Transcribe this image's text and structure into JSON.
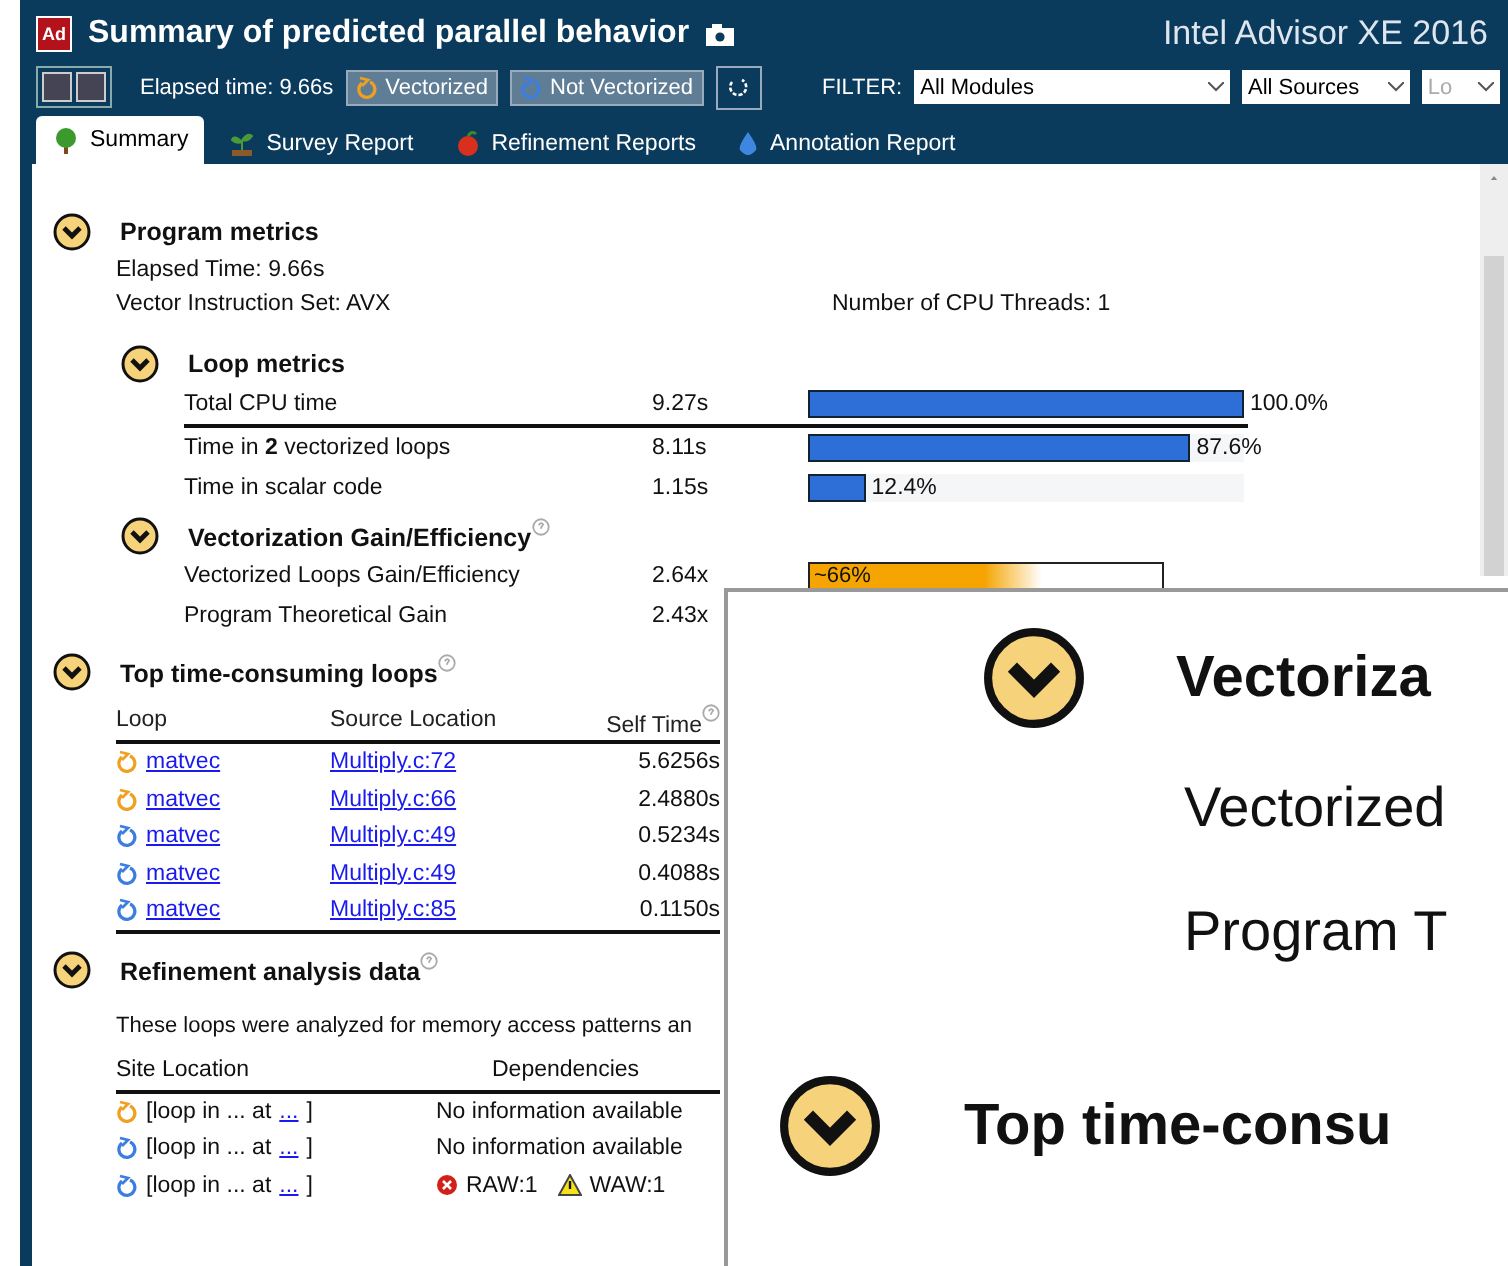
{
  "header": {
    "logo": "Ad",
    "title": "Summary of predicted parallel behavior",
    "app_name": "Intel Advisor XE 2016"
  },
  "toolbar": {
    "elapsed": "Elapsed time: 9.66s",
    "toggles": [
      {
        "label": "Vectorized",
        "kind": "vectorized",
        "selected": true
      },
      {
        "label": "Not Vectorized",
        "kind": "scalar",
        "selected": true
      }
    ],
    "filter_label": "FILTER:",
    "filters": [
      "All Modules",
      "All Sources",
      "Lo"
    ]
  },
  "tabs": [
    {
      "label": "Summary",
      "kind": "tree",
      "selected": true
    },
    {
      "label": "Survey Report",
      "kind": "sprout",
      "selected": false
    },
    {
      "label": "Refinement Reports",
      "kind": "fruit",
      "selected": false
    },
    {
      "label": "Annotation Report",
      "kind": "drop",
      "selected": false
    }
  ],
  "program_metrics": {
    "title": "Program metrics",
    "expanded": true,
    "elapsed": "Elapsed Time: 9.66s",
    "vector_set": "Vector Instruction Set: AVX",
    "cpu_threads": "Number of CPU Threads: 1"
  },
  "loop_metrics": {
    "title": "Loop metrics",
    "expanded": true,
    "rows": [
      {
        "label": "Total CPU time",
        "value": "9.27s",
        "level": 1.0,
        "reading": "100.0%"
      },
      {
        "label": "Time in **2** vectorized loops",
        "value": "8.11s",
        "level": 0.876,
        "reading": "87.6%"
      },
      {
        "label": "Time in scalar code",
        "value": "1.15s",
        "level": 0.124,
        "reading": "12.4%"
      }
    ]
  },
  "vectorization": {
    "title": "Vectorization Gain/Efficiency",
    "expanded": true,
    "rows": [
      {
        "label": "Vectorized Loops Gain/Efficiency",
        "value": "2.64x",
        "level": 0.66,
        "reading": "~66%"
      },
      {
        "label": "Program Theoretical Gain",
        "value": "2.43x"
      }
    ]
  },
  "top_loops": {
    "title": "Top time-consuming loops",
    "expanded": true,
    "columns": [
      "Loop",
      "Source Location",
      "Self Time"
    ],
    "rows": [
      {
        "kind": "vectorized",
        "loop": "matvec",
        "source": "Multiply.c:72",
        "self_time": "5.6256s"
      },
      {
        "kind": "vectorized",
        "loop": "matvec",
        "source": "Multiply.c:66",
        "self_time": "2.4880s"
      },
      {
        "kind": "scalar",
        "loop": "matvec",
        "source": "Multiply.c:49",
        "self_time": "0.5234s"
      },
      {
        "kind": "scalar",
        "loop": "matvec",
        "source": "Multiply.c:49",
        "self_time": "0.4088s"
      },
      {
        "kind": "scalar",
        "loop": "matvec",
        "source": "Multiply.c:85",
        "self_time": "0.1150s"
      }
    ]
  },
  "refinement": {
    "title": "Refinement analysis data",
    "expanded": true,
    "description": "These loops were analyzed for memory access patterns an",
    "columns": [
      "Site Location",
      "Dependencies"
    ],
    "rows": [
      {
        "kind": "vectorized",
        "site": "[loop in  ...  at",
        "link": "...",
        "close": "]",
        "dependencies": "No information available"
      },
      {
        "kind": "scalar",
        "site": "[loop in  ...  at",
        "link": "...",
        "close": "]",
        "dependencies": "No information available"
      },
      {
        "kind": "scalar",
        "site": "[loop in  ...  at",
        "link": "...",
        "close": "]",
        "issues": [
          {
            "kind": "error",
            "label": "RAW:1"
          },
          {
            "kind": "warning",
            "label": "WAW:1"
          }
        ]
      }
    ]
  },
  "magnifier": {
    "heading_1": "Vectoriza",
    "line_1": "Vectorized",
    "line_2": "Program T",
    "heading_2": "Top time-consu"
  }
}
